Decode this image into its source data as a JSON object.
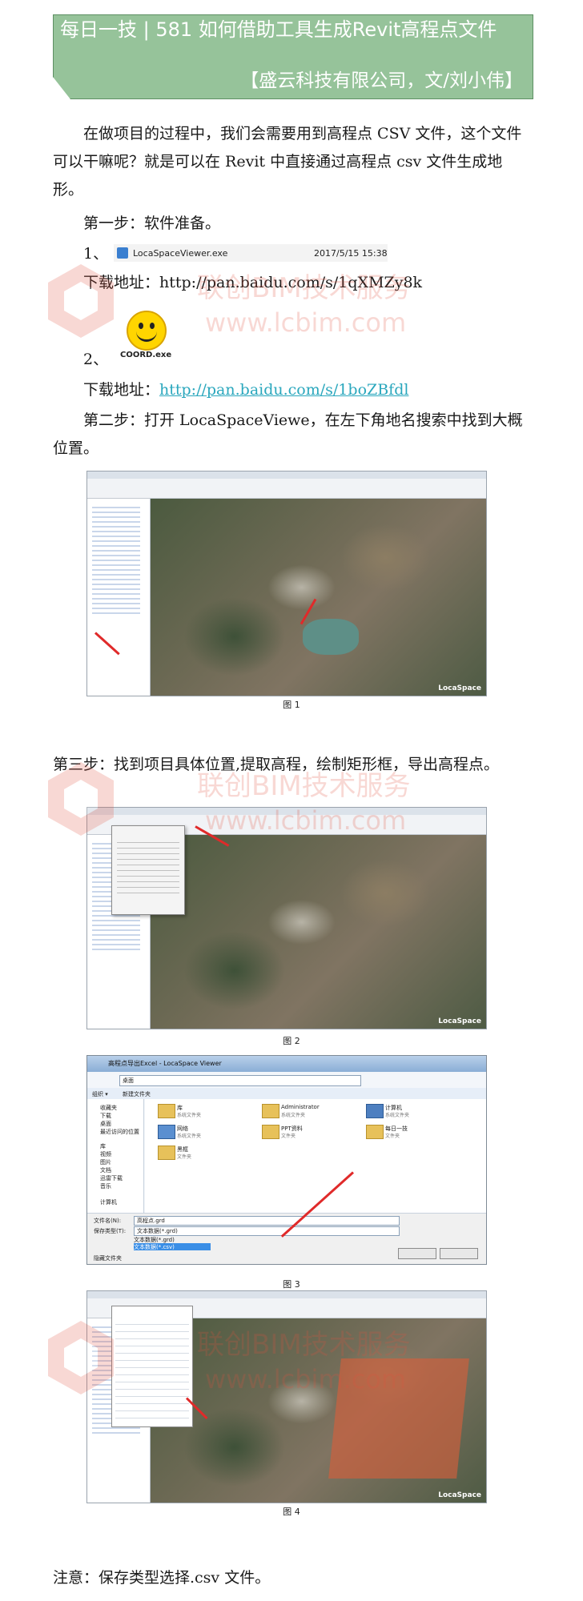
{
  "header": {
    "title": "每日一技 | 581 如何借助工具生成Revit高程点文件",
    "author": "【盛云科技有限公司，文/刘小伟】"
  },
  "intro": "在做项目的过程中，我们会需要用到高程点 CSV 文件，这个文件可以干嘛呢？就是可以在 Revit 中直接通过高程点 csv 文件生成地形。",
  "step1": {
    "heading": "第一步：软件准备。",
    "item1_marker": "1、",
    "file_name": "LocaSpaceViewer.exe",
    "file_date": "2017/5/15 15:38",
    "download1": "下载地址：http://pan.baidu.com/s/1qXMZy8k",
    "item2_marker": "2、",
    "coord_label": "COORD.exe",
    "download2_prefix": "下载地址：",
    "download2_link": "http://pan.baidu.com/s/1boZBfdl"
  },
  "step2": "第二步：打开 LocaSpaceViewe，在左下角地名搜索中找到大概位置。",
  "step3": "第三步：找到项目具体位置,提取高程，绘制矩形框，导出高程点。",
  "captions": [
    "图 1",
    "图 2",
    "图 3",
    "图 4"
  ],
  "map_brand": "LocaSpace",
  "save_dialog": {
    "title": "高程点导出Excel - LocaSpace Viewer",
    "address": "桌面",
    "organize": "组织 ▾",
    "new_folder": "新建文件夹",
    "nav_items": [
      "收藏夹",
      "下载",
      "桌面",
      "最近访问的位置",
      "库",
      "视频",
      "图片",
      "文档",
      "迅雷下载",
      "音乐",
      "计算机"
    ],
    "files": [
      {
        "name": "库",
        "sub": "系统文件夹"
      },
      {
        "name": "Administrator",
        "sub": "系统文件夹"
      },
      {
        "name": "计算机",
        "sub": "系统文件夹"
      },
      {
        "name": "网络",
        "sub": "系统文件夹"
      },
      {
        "name": "PPT资料",
        "sub": "文件夹"
      },
      {
        "name": "每日一技",
        "sub": "文件夹"
      },
      {
        "name": "黑框",
        "sub": "文件夹"
      }
    ],
    "filename_label": "文件名(N):",
    "filename_value": "高程点.grd",
    "type_label": "保存类型(T):",
    "type_value": "文本数据(*.grd)",
    "options": [
      "文本数据(*.grd)",
      "文本数据(*.csv)"
    ],
    "hide_folders": "隐藏文件夹"
  },
  "note": "注意：保存类型选择.csv 文件。",
  "watermark": {
    "line1": "联创BIM技术服务",
    "line2": "www.lcbim.com"
  }
}
